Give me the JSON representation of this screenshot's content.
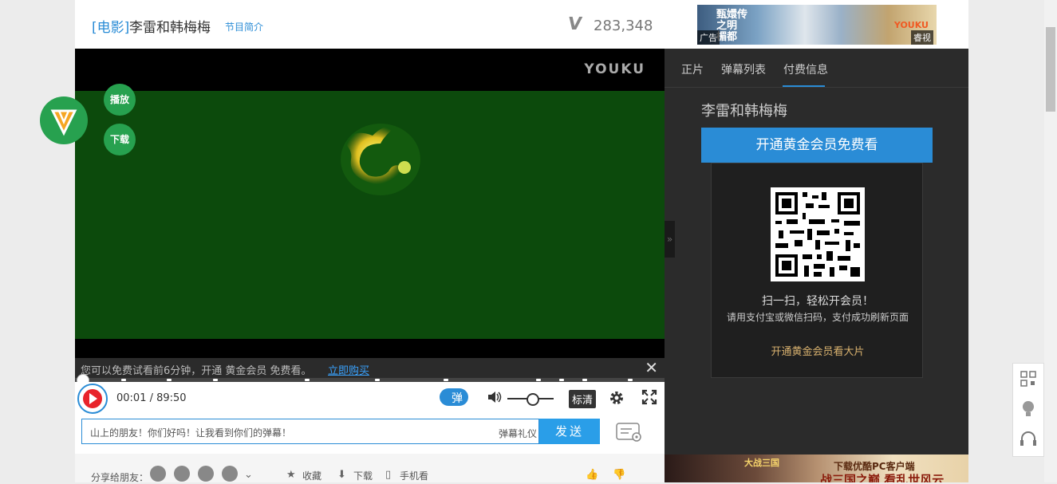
{
  "header": {
    "title_prefix": "[电影]",
    "title_name": "李雷和韩梅梅",
    "intro_link": "节目简介",
    "view_count": "283,348",
    "ad": {
      "tag": "广告",
      "title": "甄嬛传之明 楣都",
      "brand": "YOUKU",
      "brand2": "睿视"
    }
  },
  "player": {
    "watermark": "YOUKU",
    "trial_text": "您可以免费试看前6分钟，开通 黄金会员 免费看。",
    "buy_link": "立即购买",
    "close_glyph": "✕",
    "time": "00:01 / 89:50",
    "danmu_toggle": "弹",
    "quality": "标清",
    "progress": 0.0002
  },
  "danmu": {
    "placeholder": "山上的朋友！你们好吗！让我看到你们的弹幕！",
    "etiquette": "弹幕礼仪",
    "send": "发送"
  },
  "share": {
    "label": "分享给朋友：",
    "favorite": "收藏",
    "download": "下载",
    "mobile": "手机看"
  },
  "side_buttons": {
    "play": "播放",
    "download": "下载"
  },
  "panel": {
    "tabs": [
      "正片",
      "弹幕列表",
      "付费信息"
    ],
    "title": "李雷和韩梅梅",
    "vip_button": "开通黄金会员免费看",
    "scan_text": "扫一扫，轻松开会员！",
    "scan_sub": "请用支付宝或微信扫码，支付成功刷新页面",
    "gold_link": "开通黄金会员看大片",
    "collapse": "»"
  },
  "bottom_ad": {
    "line1": "下载优酷PC客户端",
    "line2": "战三国之巅 看乱世风云",
    "logo": "大战三国"
  },
  "colors": {
    "brand_blue": "#2a8cd6",
    "vip_green": "#27a14f",
    "gold": "#d9b26f"
  }
}
